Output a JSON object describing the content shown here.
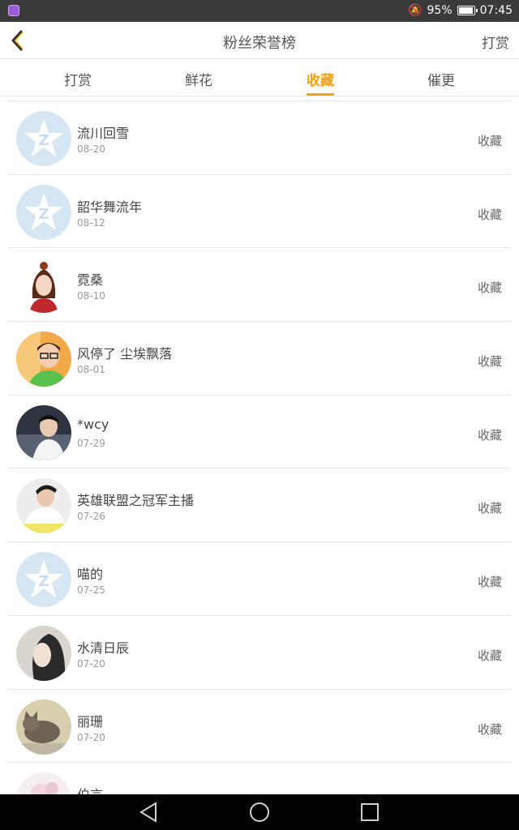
{
  "status_bar": {
    "battery": "95%",
    "time": "07:45",
    "battery_level": 0.95
  },
  "header": {
    "title": "粉丝荣誉榜",
    "action": "打赏"
  },
  "tabs": [
    {
      "label": "打赏",
      "active": false
    },
    {
      "label": "鲜花",
      "active": false
    },
    {
      "label": "收藏",
      "active": true
    },
    {
      "label": "催更",
      "active": false
    }
  ],
  "list": [
    {
      "name": "流川回雪",
      "date": "08-20",
      "type": "收藏",
      "avatar": "default-qq-avatar"
    },
    {
      "name": "韶华舞流年",
      "date": "08-12",
      "type": "收藏",
      "avatar": "default-qq-avatar"
    },
    {
      "name": "霓桑",
      "date": "08-10",
      "type": "收藏",
      "avatar": "anime-girl-avatar"
    },
    {
      "name": "风停了 尘埃飘落",
      "date": "08-01",
      "type": "收藏",
      "avatar": "boy-glasses-avatar"
    },
    {
      "name": "*wcy",
      "date": "07-29",
      "type": "收藏",
      "avatar": "man-photo-avatar"
    },
    {
      "name": "英雄联盟之冠军主播",
      "date": "07-26",
      "type": "收藏",
      "avatar": "boy-white-shirt-avatar"
    },
    {
      "name": "喵的",
      "date": "07-25",
      "type": "收藏",
      "avatar": "default-qq-avatar"
    },
    {
      "name": "水清日辰",
      "date": "07-20",
      "type": "收藏",
      "avatar": "dark-hair-avatar"
    },
    {
      "name": "丽珊",
      "date": "07-20",
      "type": "收藏",
      "avatar": "cat-avatar"
    },
    {
      "name": "伯言",
      "date": "",
      "type": "",
      "avatar": "flower-avatar"
    }
  ],
  "colors": {
    "accent": "#f5a10e",
    "default_avatar_bg": "#d6e6f3"
  }
}
